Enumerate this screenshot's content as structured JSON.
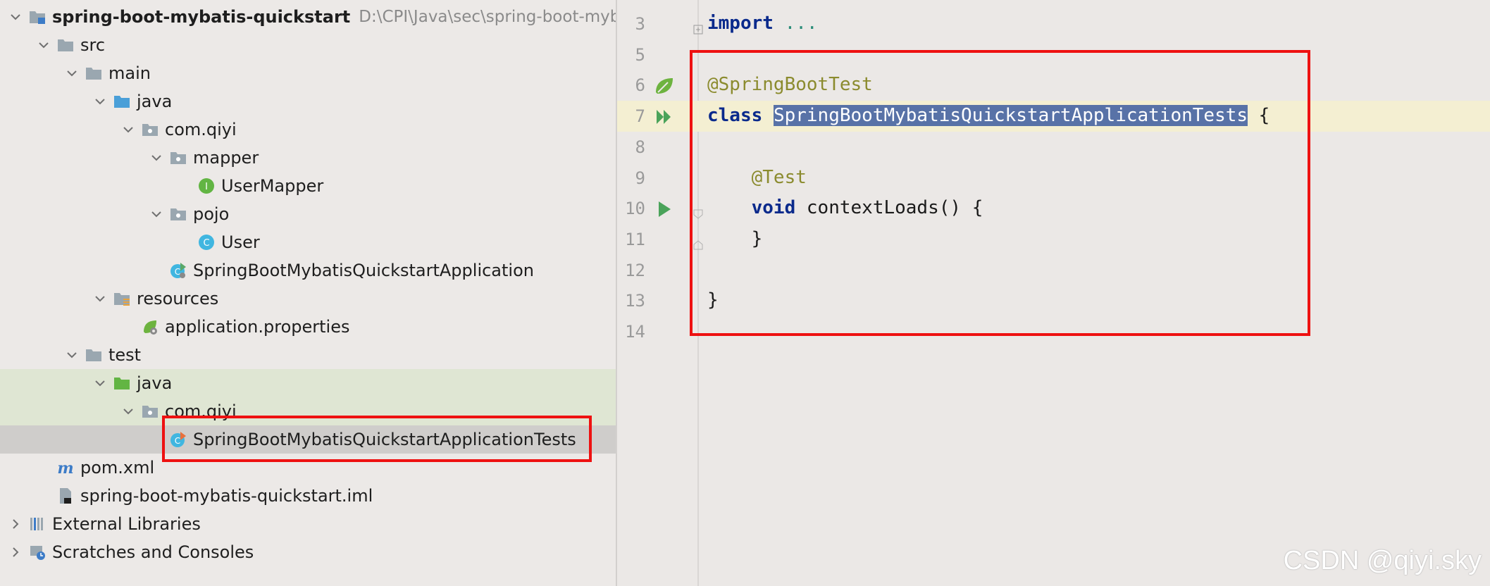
{
  "project_tree": {
    "rows": [
      {
        "indent": 0,
        "arrow": "down",
        "icon": "module-folder",
        "label": "spring-boot-mybatis-quickstart",
        "bold": true,
        "path": "D:\\CPI\\Java\\sec\\spring-boot-myba"
      },
      {
        "indent": 1,
        "arrow": "down",
        "icon": "folder",
        "label": "src"
      },
      {
        "indent": 2,
        "arrow": "down",
        "icon": "folder",
        "label": "main"
      },
      {
        "indent": 3,
        "arrow": "down",
        "icon": "source-folder",
        "label": "java"
      },
      {
        "indent": 4,
        "arrow": "down",
        "icon": "package",
        "label": "com.qiyi"
      },
      {
        "indent": 5,
        "arrow": "down",
        "icon": "package",
        "label": "mapper"
      },
      {
        "indent": 6,
        "arrow": "none",
        "icon": "interface",
        "label": "UserMapper"
      },
      {
        "indent": 5,
        "arrow": "down",
        "icon": "package",
        "label": "pojo"
      },
      {
        "indent": 6,
        "arrow": "none",
        "icon": "class",
        "label": "User"
      },
      {
        "indent": 5,
        "arrow": "none",
        "icon": "spring-class",
        "label": "SpringBootMybatisQuickstartApplication"
      },
      {
        "indent": 3,
        "arrow": "down",
        "icon": "resources-folder",
        "label": "resources"
      },
      {
        "indent": 4,
        "arrow": "none",
        "icon": "spring-properties",
        "label": "application.properties"
      },
      {
        "indent": 2,
        "arrow": "down",
        "icon": "folder",
        "label": "test"
      },
      {
        "indent": 3,
        "arrow": "down",
        "icon": "test-folder",
        "label": "java",
        "highlight": "green"
      },
      {
        "indent": 4,
        "arrow": "down",
        "icon": "package",
        "label": "com.qiyi",
        "highlight": "green"
      },
      {
        "indent": 5,
        "arrow": "none",
        "icon": "test-class",
        "label": "SpringBootMybatisQuickstartApplicationTests",
        "highlight": "gray"
      },
      {
        "indent": 1,
        "arrow": "none",
        "icon": "maven",
        "label": "pom.xml"
      },
      {
        "indent": 1,
        "arrow": "none",
        "icon": "iml-file",
        "label": "spring-boot-mybatis-quickstart.iml"
      },
      {
        "indent": 0,
        "arrow": "right",
        "icon": "libraries",
        "label": "External Libraries"
      },
      {
        "indent": 0,
        "arrow": "right",
        "icon": "scratches",
        "label": "Scratches and Consoles"
      }
    ]
  },
  "editor": {
    "lines": [
      {
        "num": "3",
        "gutter": "",
        "fold": "plus",
        "tokens": [
          {
            "t": "import",
            "c": "kw"
          },
          {
            "t": " ",
            "c": ""
          },
          {
            "t": "...",
            "c": "dim"
          }
        ]
      },
      {
        "num": "5",
        "gutter": "",
        "fold": "",
        "tokens": []
      },
      {
        "num": "6",
        "gutter": "leaf-icon",
        "fold": "",
        "tokens": [
          {
            "t": "@SpringBootTest",
            "c": "ann"
          }
        ]
      },
      {
        "num": "7",
        "gutter": "run-all-icon",
        "fold": "",
        "caret": true,
        "tokens": [
          {
            "t": "class",
            "c": "kw"
          },
          {
            "t": " ",
            "c": ""
          },
          {
            "t": "SpringBootMybatisQuickstartApplicationTests",
            "c": "sel"
          },
          {
            "t": " {",
            "c": ""
          }
        ]
      },
      {
        "num": "8",
        "gutter": "",
        "fold": "",
        "tokens": []
      },
      {
        "num": "9",
        "gutter": "",
        "fold": "",
        "tokens": [
          {
            "t": "    ",
            "c": ""
          },
          {
            "t": "@Test",
            "c": "ann"
          }
        ]
      },
      {
        "num": "10",
        "gutter": "run-icon",
        "fold": "open",
        "tokens": [
          {
            "t": "    ",
            "c": ""
          },
          {
            "t": "void",
            "c": "kw"
          },
          {
            "t": " contextLoads() {",
            "c": ""
          }
        ]
      },
      {
        "num": "11",
        "gutter": "",
        "fold": "close",
        "tokens": [
          {
            "t": "    }",
            "c": ""
          }
        ]
      },
      {
        "num": "12",
        "gutter": "",
        "fold": "",
        "tokens": []
      },
      {
        "num": "13",
        "gutter": "",
        "fold": "",
        "tokens": [
          {
            "t": "}",
            "c": ""
          }
        ]
      },
      {
        "num": "14",
        "gutter": "",
        "fold": "",
        "tokens": []
      }
    ]
  },
  "watermark": "CSDN @qiyi.sky",
  "colors": {
    "annotation_box": "#ee1111",
    "selection": "#5872a7",
    "keyword": "#0a2a8c",
    "annotation": "#8b8b2e"
  }
}
